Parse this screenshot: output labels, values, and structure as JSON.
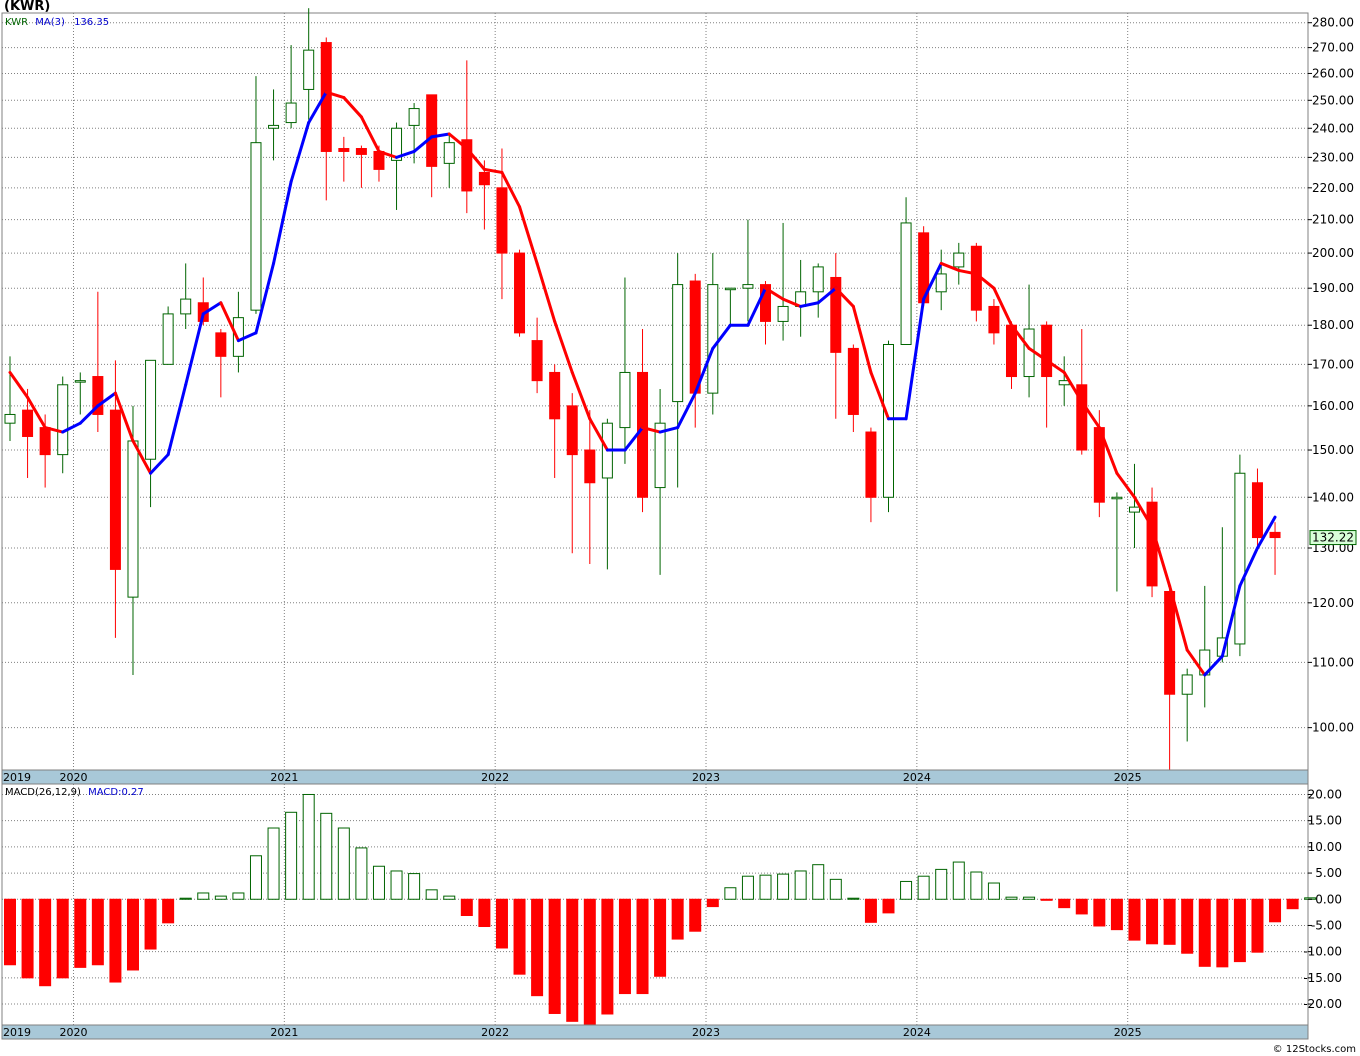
{
  "chart_data": [
    {
      "type": "candlestick",
      "title": "(KWR)",
      "legend": {
        "ticker": "KWR",
        "ma_label": "MA(3)",
        "ma_value": "136.35"
      },
      "last_price_label": "132.22",
      "ylim": [
        94,
        284
      ],
      "yscale": "log",
      "yticks": [
        "100.00",
        "110.00",
        "120.00",
        "130.00",
        "140.00",
        "150.00",
        "160.00",
        "170.00",
        "180.00",
        "190.00",
        "200.00",
        "210.00",
        "220.00",
        "230.00",
        "240.00",
        "250.00",
        "260.00",
        "270.00",
        "280.00"
      ],
      "years": [
        "2019",
        "2020",
        "2021",
        "2022",
        "2023",
        "2024",
        "2025"
      ],
      "year_index": [
        0,
        4,
        16,
        28,
        40,
        52,
        64
      ],
      "candles": [
        {
          "o": 156,
          "h": 172,
          "l": 152,
          "c": 158
        },
        {
          "o": 159,
          "h": 164,
          "l": 144,
          "c": 153
        },
        {
          "o": 155,
          "h": 158,
          "l": 142,
          "c": 149
        },
        {
          "o": 149,
          "h": 167,
          "l": 145,
          "c": 165
        },
        {
          "o": 166,
          "h": 168,
          "l": 158,
          "c": 166
        },
        {
          "o": 167,
          "h": 189,
          "l": 154,
          "c": 158
        },
        {
          "o": 159,
          "h": 171,
          "l": 114,
          "c": 126
        },
        {
          "o": 121,
          "h": 160,
          "l": 108,
          "c": 152
        },
        {
          "o": 148,
          "h": 166,
          "l": 138,
          "c": 171
        },
        {
          "o": 170,
          "h": 185,
          "l": 170,
          "c": 183
        },
        {
          "o": 183,
          "h": 197,
          "l": 179,
          "c": 187
        },
        {
          "o": 186,
          "h": 193,
          "l": 180,
          "c": 181
        },
        {
          "o": 178,
          "h": 179,
          "l": 162,
          "c": 172
        },
        {
          "o": 172,
          "h": 189,
          "l": 168,
          "c": 182
        },
        {
          "o": 184,
          "h": 259,
          "l": 183,
          "c": 235
        },
        {
          "o": 240,
          "h": 254,
          "l": 229,
          "c": 241
        },
        {
          "o": 242,
          "h": 271,
          "l": 240,
          "c": 249
        },
        {
          "o": 254,
          "h": 286,
          "l": 243,
          "c": 269
        },
        {
          "o": 272,
          "h": 274,
          "l": 216,
          "c": 232
        },
        {
          "o": 233,
          "h": 237,
          "l": 222,
          "c": 232
        },
        {
          "o": 233,
          "h": 234,
          "l": 220,
          "c": 231
        },
        {
          "o": 232,
          "h": 234,
          "l": 222,
          "c": 226
        },
        {
          "o": 229,
          "h": 242,
          "l": 213,
          "c": 240
        },
        {
          "o": 241,
          "h": 249,
          "l": 228,
          "c": 247
        },
        {
          "o": 252,
          "h": 252,
          "l": 217,
          "c": 227
        },
        {
          "o": 228,
          "h": 238,
          "l": 220,
          "c": 235
        },
        {
          "o": 236,
          "h": 265,
          "l": 212,
          "c": 219
        },
        {
          "o": 225,
          "h": 229,
          "l": 207,
          "c": 221
        },
        {
          "o": 220,
          "h": 233,
          "l": 187,
          "c": 200
        },
        {
          "o": 200,
          "h": 201,
          "l": 177,
          "c": 178
        },
        {
          "o": 176,
          "h": 182,
          "l": 163,
          "c": 166
        },
        {
          "o": 168,
          "h": 170,
          "l": 144,
          "c": 157
        },
        {
          "o": 160,
          "h": 163,
          "l": 129,
          "c": 149
        },
        {
          "o": 150,
          "h": 159,
          "l": 127,
          "c": 143
        },
        {
          "o": 144,
          "h": 157,
          "l": 126,
          "c": 156
        },
        {
          "o": 155,
          "h": 193,
          "l": 147,
          "c": 168
        },
        {
          "o": 168,
          "h": 179,
          "l": 137,
          "c": 140
        },
        {
          "o": 142,
          "h": 164,
          "l": 125,
          "c": 156
        },
        {
          "o": 161,
          "h": 200,
          "l": 142,
          "c": 191
        },
        {
          "o": 192,
          "h": 194,
          "l": 155,
          "c": 163
        },
        {
          "o": 163,
          "h": 200,
          "l": 158,
          "c": 191
        },
        {
          "o": 190,
          "h": 190,
          "l": 180,
          "c": 190
        },
        {
          "o": 190,
          "h": 210,
          "l": 181,
          "c": 191
        },
        {
          "o": 191,
          "h": 192,
          "l": 175,
          "c": 181
        },
        {
          "o": 181,
          "h": 209,
          "l": 176,
          "c": 185
        },
        {
          "o": 185,
          "h": 198,
          "l": 177,
          "c": 189
        },
        {
          "o": 189,
          "h": 197,
          "l": 182,
          "c": 196
        },
        {
          "o": 193,
          "h": 200,
          "l": 157,
          "c": 173
        },
        {
          "o": 174,
          "h": 175,
          "l": 154,
          "c": 158
        },
        {
          "o": 154,
          "h": 155,
          "l": 135,
          "c": 140
        },
        {
          "o": 140,
          "h": 176,
          "l": 137,
          "c": 175
        },
        {
          "o": 175,
          "h": 217,
          "l": 175,
          "c": 209
        },
        {
          "o": 206,
          "h": 208,
          "l": 185,
          "c": 186
        },
        {
          "o": 189,
          "h": 201,
          "l": 184,
          "c": 194
        },
        {
          "o": 196,
          "h": 203,
          "l": 191,
          "c": 200
        },
        {
          "o": 202,
          "h": 203,
          "l": 181,
          "c": 184
        },
        {
          "o": 185,
          "h": 187,
          "l": 175,
          "c": 178
        },
        {
          "o": 180,
          "h": 181,
          "l": 164,
          "c": 167
        },
        {
          "o": 167,
          "h": 191,
          "l": 162,
          "c": 179
        },
        {
          "o": 180,
          "h": 181,
          "l": 155,
          "c": 167
        },
        {
          "o": 165,
          "h": 172,
          "l": 160,
          "c": 166
        },
        {
          "o": 165,
          "h": 179,
          "l": 149,
          "c": 150
        },
        {
          "o": 155,
          "h": 159,
          "l": 136,
          "c": 139
        },
        {
          "o": 140,
          "h": 141,
          "l": 122,
          "c": 140
        },
        {
          "o": 137,
          "h": 147,
          "l": 130,
          "c": 138
        },
        {
          "o": 139,
          "h": 142,
          "l": 121,
          "c": 123
        },
        {
          "o": 122,
          "h": 123,
          "l": 94,
          "c": 105
        },
        {
          "o": 105,
          "h": 109,
          "l": 98,
          "c": 108
        },
        {
          "o": 108,
          "h": 123,
          "l": 103,
          "c": 112
        },
        {
          "o": 111,
          "h": 134,
          "l": 110,
          "c": 114
        },
        {
          "o": 113,
          "h": 149,
          "l": 111,
          "c": 145
        },
        {
          "o": 143,
          "h": 146,
          "l": 130,
          "c": 132
        },
        {
          "o": 133,
          "h": 135,
          "l": 125,
          "c": 132
        }
      ],
      "ma3": [
        168,
        162,
        155,
        154,
        156,
        160,
        163,
        152,
        145,
        149,
        165,
        183,
        186,
        176,
        178,
        197,
        222,
        242,
        253,
        251,
        244,
        232,
        230,
        232,
        237,
        238,
        233,
        226,
        225,
        214,
        197,
        181,
        168,
        157,
        150,
        150,
        155,
        154,
        155,
        163,
        174,
        180,
        180,
        190,
        187,
        185,
        186,
        190,
        185,
        168,
        157,
        157,
        187,
        197,
        195,
        194,
        190,
        180,
        174,
        171,
        168,
        161,
        155,
        145,
        140,
        134,
        123,
        112,
        108,
        111,
        123,
        130,
        136
      ],
      "ma_colors": [
        "#ff0000",
        "#0000ff"
      ]
    },
    {
      "type": "bar",
      "legend": {
        "label": "MACD(26,12,9)",
        "value_label": "MACD:0.27"
      },
      "ylim": [
        -24,
        22
      ],
      "yticks": [
        "20.00",
        "15.00",
        "10.00",
        "5.00",
        "0.00",
        "-5.00",
        "-10.00",
        "-15.00",
        "-20.00"
      ],
      "ytick_values": [
        20,
        15,
        10,
        5,
        0,
        -5,
        -10,
        -15,
        -20
      ],
      "years": [
        "2019",
        "2020",
        "2021",
        "2022",
        "2023",
        "2024",
        "2025"
      ],
      "values": [
        -12.5,
        -15,
        -16.5,
        -15,
        -13,
        -12.5,
        -15.8,
        -13.5,
        -9.5,
        -4.5,
        0.2,
        1.2,
        0.6,
        1.2,
        8.3,
        13.6,
        16.6,
        20,
        16.4,
        13.6,
        9.8,
        6.3,
        5.4,
        4.9,
        1.8,
        0.6,
        -3.1,
        -5.2,
        -9.3,
        -14.3,
        -18.4,
        -21.8,
        -23.3,
        -24.1,
        -21.9,
        -18,
        -18,
        -14.7,
        -7.6,
        -6.1,
        -1.4,
        2.2,
        4.4,
        4.6,
        4.8,
        5.4,
        6.6,
        3.8,
        0.2,
        -4.4,
        -2.6,
        3.4,
        4.4,
        5.7,
        7.1,
        5.2,
        3.1,
        0.4,
        0.4,
        -0.2,
        -1.6,
        -2.8,
        -5.1,
        -5.8,
        -7.8,
        -8.5,
        -8.6,
        -10.3,
        -12.8,
        -12.9,
        -11.9,
        -10.1,
        -4.3,
        -1.8,
        0.27
      ]
    }
  ],
  "colors": {
    "down": "#ff0000",
    "up_fill": "#ffffff",
    "up_outline": "#006400",
    "grid": "#808080",
    "axis_band": "#a8c8d8",
    "frame": "#808080",
    "label_box_fill": "#d8ffd8",
    "ma_down": "#ff0000",
    "ma_up": "#0000ff"
  },
  "credit": "© 12Stocks.com"
}
